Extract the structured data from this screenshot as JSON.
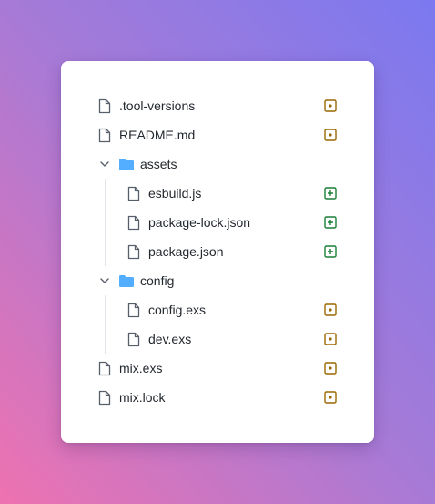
{
  "tree": {
    "items": [
      {
        "label": ".tool-versions",
        "kind": "file",
        "status": "modified"
      },
      {
        "label": "README.md",
        "kind": "file",
        "status": "modified"
      },
      {
        "label": "assets",
        "kind": "folder",
        "expanded": true
      },
      {
        "label": "esbuild.js",
        "kind": "file",
        "status": "added"
      },
      {
        "label": "package-lock.json",
        "kind": "file",
        "status": "added"
      },
      {
        "label": "package.json",
        "kind": "file",
        "status": "added"
      },
      {
        "label": "config",
        "kind": "folder",
        "expanded": true
      },
      {
        "label": "config.exs",
        "kind": "file",
        "status": "modified"
      },
      {
        "label": "dev.exs",
        "kind": "file",
        "status": "modified"
      },
      {
        "label": "mix.exs",
        "kind": "file",
        "status": "modified"
      },
      {
        "label": "mix.lock",
        "kind": "file",
        "status": "modified"
      }
    ]
  },
  "colors": {
    "modified": "#9a6700",
    "added": "#1a7f37",
    "folder": "#54aeff",
    "file_icon": "#57606a",
    "chevron": "#57606a"
  }
}
